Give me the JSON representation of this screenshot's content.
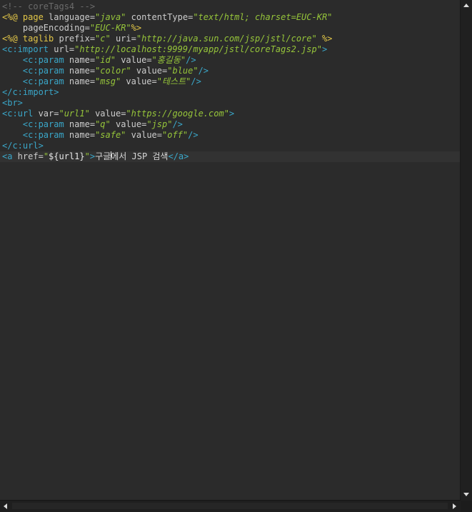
{
  "editor": {
    "lines": [
      [
        {
          "c": "t-comment",
          "t": "<!-- coreTags4 -->"
        }
      ],
      [
        {
          "c": "t-kw",
          "t": "<%@ page"
        },
        {
          "c": "t-attr",
          "t": " language="
        },
        {
          "c": "t-val",
          "t": "\"java\""
        },
        {
          "c": "t-attr",
          "t": " contentType="
        },
        {
          "c": "t-val",
          "t": "\"text/html; charset=EUC-KR\""
        }
      ],
      [
        {
          "c": "t-attr",
          "t": "    pageEncoding="
        },
        {
          "c": "t-val",
          "t": "\"EUC-KR\""
        },
        {
          "c": "t-kw",
          "t": "%>"
        }
      ],
      [
        {
          "c": "t-kw",
          "t": "<%@ taglib"
        },
        {
          "c": "t-attr",
          "t": " prefix="
        },
        {
          "c": "t-val",
          "t": "\"c\""
        },
        {
          "c": "t-attr",
          "t": " uri="
        },
        {
          "c": "t-val",
          "t": "\"http://java.sun.com/jsp/jstl/core\""
        },
        {
          "c": "t-kw",
          "t": " %>"
        }
      ],
      [
        {
          "c": "t-tag",
          "t": "<c:import"
        },
        {
          "c": "t-attr",
          "t": " url="
        },
        {
          "c": "t-val",
          "t": "\"http://localhost:9999/myapp/jstl/coreTags2.jsp\""
        },
        {
          "c": "t-tag",
          "t": ">"
        }
      ],
      [
        {
          "c": "t-tag",
          "t": "    <c:param"
        },
        {
          "c": "t-attr",
          "t": " name="
        },
        {
          "c": "t-val",
          "t": "\"id\""
        },
        {
          "c": "t-attr",
          "t": " value="
        },
        {
          "c": "t-val",
          "t": "\"홍길동\""
        },
        {
          "c": "t-tag",
          "t": "/>"
        }
      ],
      [
        {
          "c": "t-tag",
          "t": "    <c:param"
        },
        {
          "c": "t-attr",
          "t": " name="
        },
        {
          "c": "t-val",
          "t": "\"color\""
        },
        {
          "c": "t-attr",
          "t": " value="
        },
        {
          "c": "t-val",
          "t": "\"blue\""
        },
        {
          "c": "t-tag",
          "t": "/>"
        }
      ],
      [
        {
          "c": "t-tag",
          "t": "    <c:param"
        },
        {
          "c": "t-attr",
          "t": " name="
        },
        {
          "c": "t-val",
          "t": "\"msg\""
        },
        {
          "c": "t-attr",
          "t": " value="
        },
        {
          "c": "t-val",
          "t": "\"테스트\""
        },
        {
          "c": "t-tag",
          "t": "/>"
        }
      ],
      [
        {
          "c": "t-tag",
          "t": "</c:import>"
        }
      ],
      [
        {
          "c": "t-tag",
          "t": "<br>"
        }
      ],
      [
        {
          "c": "t-tag",
          "t": "<c:url"
        },
        {
          "c": "t-attr",
          "t": " var="
        },
        {
          "c": "t-val",
          "t": "\"url1\""
        },
        {
          "c": "t-attr",
          "t": " value="
        },
        {
          "c": "t-val",
          "t": "\"https://google.com\""
        },
        {
          "c": "t-tag",
          "t": ">"
        }
      ],
      [
        {
          "c": "t-tag",
          "t": "    <c:param"
        },
        {
          "c": "t-attr",
          "t": " name="
        },
        {
          "c": "t-val",
          "t": "\"q\""
        },
        {
          "c": "t-attr",
          "t": " value="
        },
        {
          "c": "t-val",
          "t": "\"jsp\""
        },
        {
          "c": "t-tag",
          "t": "/>"
        }
      ],
      [
        {
          "c": "t-tag",
          "t": "    <c:param"
        },
        {
          "c": "t-attr",
          "t": " name="
        },
        {
          "c": "t-val",
          "t": "\"safe\""
        },
        {
          "c": "t-attr",
          "t": " value="
        },
        {
          "c": "t-val",
          "t": "\"off\""
        },
        {
          "c": "t-tag",
          "t": "/>"
        }
      ],
      [
        {
          "c": "t-tag",
          "t": "</c:url>"
        }
      ],
      [
        {
          "c": "t-tag",
          "t": "<a"
        },
        {
          "c": "t-attr",
          "t": " href="
        },
        {
          "c": "t-val",
          "t": "\""
        },
        {
          "c": "t-el",
          "t": "${url1}"
        },
        {
          "c": "t-val",
          "t": "\""
        },
        {
          "c": "t-tag",
          "t": ">"
        },
        {
          "c": "t-text",
          "t": "구글"
        },
        {
          "c": "caret",
          "t": ""
        },
        {
          "c": "t-text",
          "t": "에서 JSP 검색"
        },
        {
          "c": "t-tag",
          "t": "</a>"
        }
      ]
    ],
    "current_line": 14
  },
  "scrollbars": {
    "up_icon": "arrow-up-icon",
    "down_icon": "arrow-down-icon",
    "left_icon": "arrow-left-icon",
    "right_icon": "arrow-right-icon"
  }
}
